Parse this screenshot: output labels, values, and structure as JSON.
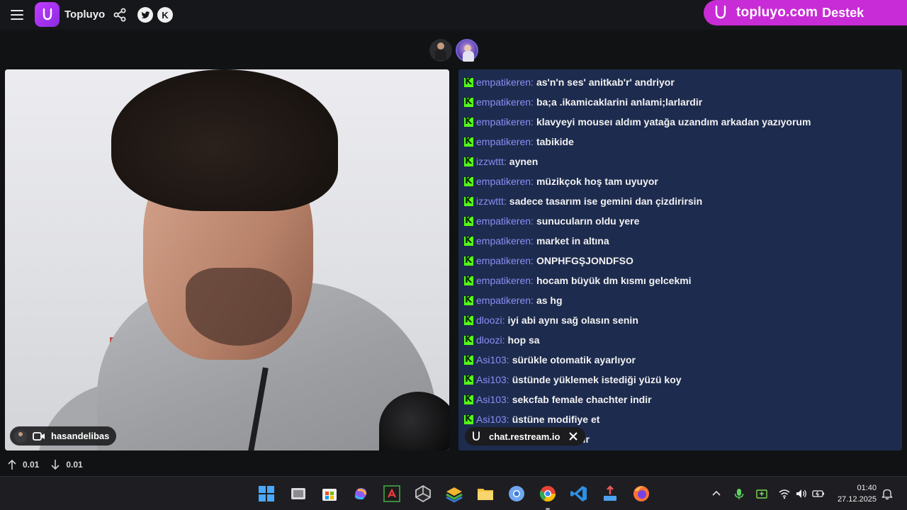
{
  "app": {
    "brand": "Topluyo",
    "banner_text": "topluyo.com",
    "banner_suffix": "Destek"
  },
  "video": {
    "streamer_name": "hasandelibas"
  },
  "chat": {
    "messages": [
      {
        "user": "empatikeren:",
        "text": "as'n'n ses' anitkab'r' andriyor"
      },
      {
        "user": "empatikeren:",
        "text": "ba;a .ikamicaklarini anlami;larlardir"
      },
      {
        "user": "empatikeren:",
        "text": "klavyeyi mouseı aldım yatağa uzandım arkadan yazıyorum"
      },
      {
        "user": "empatikeren:",
        "text": "tabikide"
      },
      {
        "user": "izzwttt:",
        "text": "aynen"
      },
      {
        "user": "empatikeren:",
        "text": "müzikçok hoş tam uyuyor"
      },
      {
        "user": "izzwttt:",
        "text": "sadece tasarım ise gemini dan çizdirirsin"
      },
      {
        "user": "empatikeren:",
        "text": "sunucuların oldu yere"
      },
      {
        "user": "empatikeren:",
        "text": "market in altına"
      },
      {
        "user": "empatikeren:",
        "text": "ONPHFGŞJONDFSO"
      },
      {
        "user": "empatikeren:",
        "text": "hocam büyük dm kısmı gelcekmi"
      },
      {
        "user": "empatikeren:",
        "text": "as hg"
      },
      {
        "user": "dloozi:",
        "text": "iyi abi aynı sağ olasın senin"
      },
      {
        "user": "dloozi:",
        "text": "hop sa"
      },
      {
        "user": "Asi103:",
        "text": "sürükle otomatik ayarlıyor"
      },
      {
        "user": "Asi103:",
        "text": "üstünde yüklemek istediği yüzü koy"
      },
      {
        "user": "Asi103:",
        "text": "sekcfab female chachter indir"
      },
      {
        "user": "Asi103:",
        "text": "üstüne modifiye et"
      },
      {
        "user": "",
        "text": "dir"
      }
    ],
    "overlay_label": "chat.restream.io",
    "kick_color": "#53fc18",
    "username_color": "#8a8ff5",
    "background_color": "#1d2b4e"
  },
  "stats": {
    "upload": "0.01",
    "download": "0.01"
  },
  "taskbar": {
    "time": "01:40",
    "date": "27.12.2025",
    "apps": [
      "start-icon",
      "file-explorer-icon",
      "store-icon",
      "copilot-icon",
      "amd-icon",
      "unity-icon",
      "layers-icon",
      "folder-icon",
      "chrome-blue-icon",
      "chrome-icon",
      "vscode-icon",
      "upload-icon",
      "firefox-icon"
    ]
  },
  "colors": {
    "brand_purple": "#c82cd6",
    "topbar_bg": "#16171a"
  }
}
